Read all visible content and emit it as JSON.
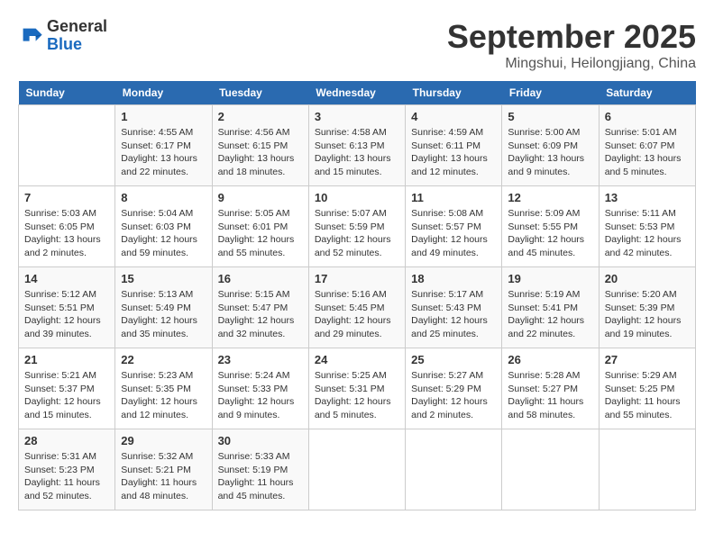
{
  "header": {
    "logo_line1": "General",
    "logo_line2": "Blue",
    "month_title": "September 2025",
    "subtitle": "Mingshui, Heilongjiang, China"
  },
  "weekdays": [
    "Sunday",
    "Monday",
    "Tuesday",
    "Wednesday",
    "Thursday",
    "Friday",
    "Saturday"
  ],
  "weeks": [
    [
      {
        "day": "",
        "info": ""
      },
      {
        "day": "1",
        "info": "Sunrise: 4:55 AM\nSunset: 6:17 PM\nDaylight: 13 hours\nand 22 minutes."
      },
      {
        "day": "2",
        "info": "Sunrise: 4:56 AM\nSunset: 6:15 PM\nDaylight: 13 hours\nand 18 minutes."
      },
      {
        "day": "3",
        "info": "Sunrise: 4:58 AM\nSunset: 6:13 PM\nDaylight: 13 hours\nand 15 minutes."
      },
      {
        "day": "4",
        "info": "Sunrise: 4:59 AM\nSunset: 6:11 PM\nDaylight: 13 hours\nand 12 minutes."
      },
      {
        "day": "5",
        "info": "Sunrise: 5:00 AM\nSunset: 6:09 PM\nDaylight: 13 hours\nand 9 minutes."
      },
      {
        "day": "6",
        "info": "Sunrise: 5:01 AM\nSunset: 6:07 PM\nDaylight: 13 hours\nand 5 minutes."
      }
    ],
    [
      {
        "day": "7",
        "info": "Sunrise: 5:03 AM\nSunset: 6:05 PM\nDaylight: 13 hours\nand 2 minutes."
      },
      {
        "day": "8",
        "info": "Sunrise: 5:04 AM\nSunset: 6:03 PM\nDaylight: 12 hours\nand 59 minutes."
      },
      {
        "day": "9",
        "info": "Sunrise: 5:05 AM\nSunset: 6:01 PM\nDaylight: 12 hours\nand 55 minutes."
      },
      {
        "day": "10",
        "info": "Sunrise: 5:07 AM\nSunset: 5:59 PM\nDaylight: 12 hours\nand 52 minutes."
      },
      {
        "day": "11",
        "info": "Sunrise: 5:08 AM\nSunset: 5:57 PM\nDaylight: 12 hours\nand 49 minutes."
      },
      {
        "day": "12",
        "info": "Sunrise: 5:09 AM\nSunset: 5:55 PM\nDaylight: 12 hours\nand 45 minutes."
      },
      {
        "day": "13",
        "info": "Sunrise: 5:11 AM\nSunset: 5:53 PM\nDaylight: 12 hours\nand 42 minutes."
      }
    ],
    [
      {
        "day": "14",
        "info": "Sunrise: 5:12 AM\nSunset: 5:51 PM\nDaylight: 12 hours\nand 39 minutes."
      },
      {
        "day": "15",
        "info": "Sunrise: 5:13 AM\nSunset: 5:49 PM\nDaylight: 12 hours\nand 35 minutes."
      },
      {
        "day": "16",
        "info": "Sunrise: 5:15 AM\nSunset: 5:47 PM\nDaylight: 12 hours\nand 32 minutes."
      },
      {
        "day": "17",
        "info": "Sunrise: 5:16 AM\nSunset: 5:45 PM\nDaylight: 12 hours\nand 29 minutes."
      },
      {
        "day": "18",
        "info": "Sunrise: 5:17 AM\nSunset: 5:43 PM\nDaylight: 12 hours\nand 25 minutes."
      },
      {
        "day": "19",
        "info": "Sunrise: 5:19 AM\nSunset: 5:41 PM\nDaylight: 12 hours\nand 22 minutes."
      },
      {
        "day": "20",
        "info": "Sunrise: 5:20 AM\nSunset: 5:39 PM\nDaylight: 12 hours\nand 19 minutes."
      }
    ],
    [
      {
        "day": "21",
        "info": "Sunrise: 5:21 AM\nSunset: 5:37 PM\nDaylight: 12 hours\nand 15 minutes."
      },
      {
        "day": "22",
        "info": "Sunrise: 5:23 AM\nSunset: 5:35 PM\nDaylight: 12 hours\nand 12 minutes."
      },
      {
        "day": "23",
        "info": "Sunrise: 5:24 AM\nSunset: 5:33 PM\nDaylight: 12 hours\nand 9 minutes."
      },
      {
        "day": "24",
        "info": "Sunrise: 5:25 AM\nSunset: 5:31 PM\nDaylight: 12 hours\nand 5 minutes."
      },
      {
        "day": "25",
        "info": "Sunrise: 5:27 AM\nSunset: 5:29 PM\nDaylight: 12 hours\nand 2 minutes."
      },
      {
        "day": "26",
        "info": "Sunrise: 5:28 AM\nSunset: 5:27 PM\nDaylight: 11 hours\nand 58 minutes."
      },
      {
        "day": "27",
        "info": "Sunrise: 5:29 AM\nSunset: 5:25 PM\nDaylight: 11 hours\nand 55 minutes."
      }
    ],
    [
      {
        "day": "28",
        "info": "Sunrise: 5:31 AM\nSunset: 5:23 PM\nDaylight: 11 hours\nand 52 minutes."
      },
      {
        "day": "29",
        "info": "Sunrise: 5:32 AM\nSunset: 5:21 PM\nDaylight: 11 hours\nand 48 minutes."
      },
      {
        "day": "30",
        "info": "Sunrise: 5:33 AM\nSunset: 5:19 PM\nDaylight: 11 hours\nand 45 minutes."
      },
      {
        "day": "",
        "info": ""
      },
      {
        "day": "",
        "info": ""
      },
      {
        "day": "",
        "info": ""
      },
      {
        "day": "",
        "info": ""
      }
    ]
  ]
}
